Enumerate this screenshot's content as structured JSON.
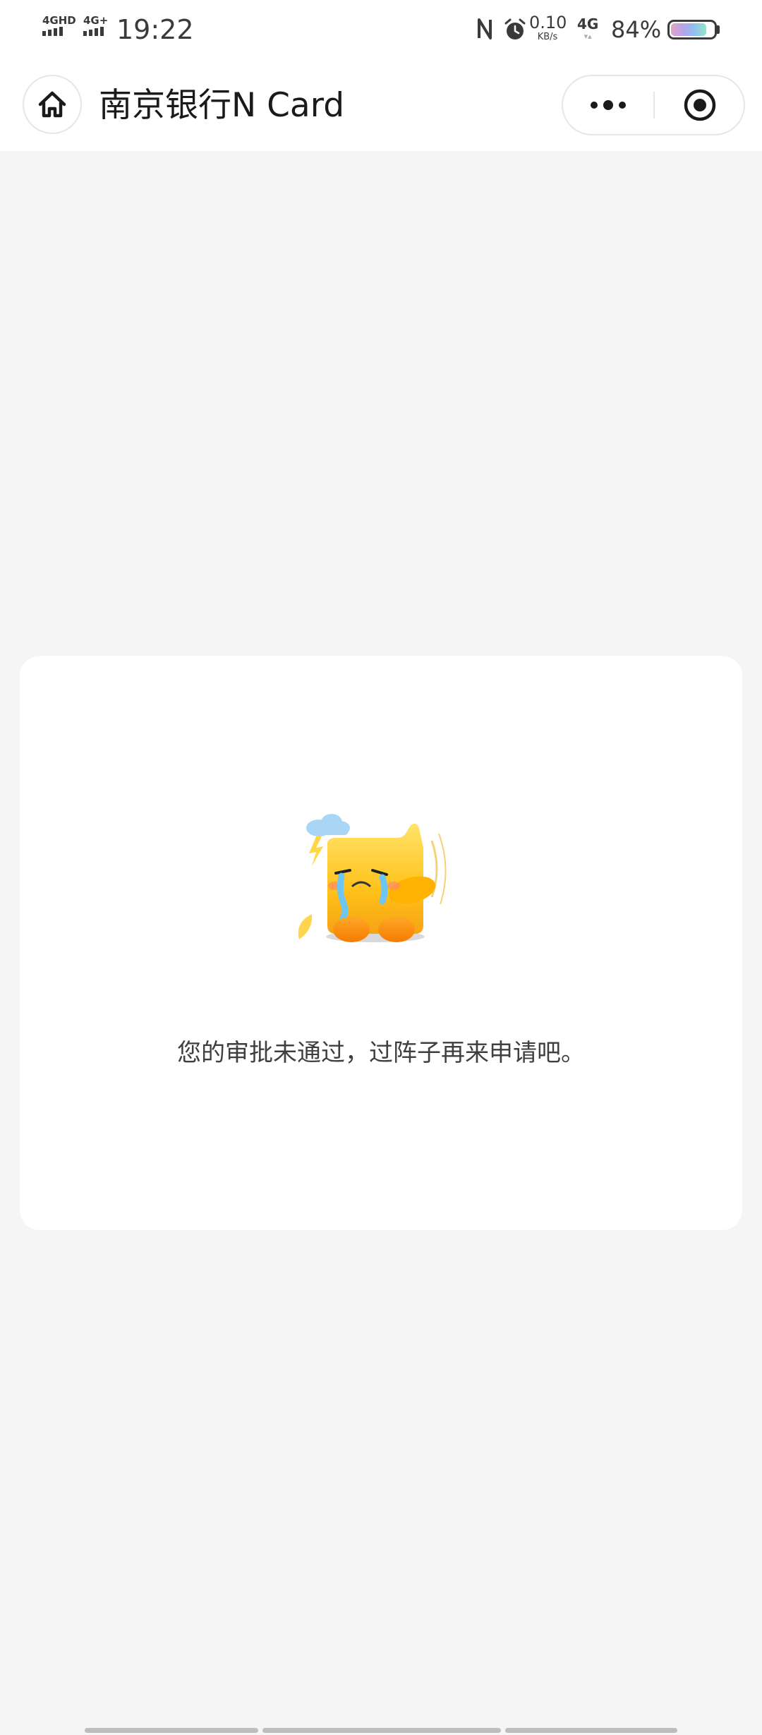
{
  "status_bar": {
    "network_left_1": "4GHD",
    "network_left_2": "4G+",
    "time": "19:22",
    "nfc_icon": "nfc-icon",
    "alarm_icon": "alarm-icon",
    "speed_value": "0.10",
    "speed_unit": "KB/s",
    "network_right": "4G",
    "battery_percent": "84%",
    "battery_level": 0.84
  },
  "nav_bar": {
    "home_icon": "home-icon",
    "title": "南京银行N Card",
    "more_icon": "more-dots-icon",
    "close_icon": "miniprogram-close-icon"
  },
  "result_card": {
    "illustration": "crying-mascot-illustration",
    "message": "您的审批未通过，过阵子再来申请吧。"
  },
  "colors": {
    "page_background": "#f5f5f5",
    "card_background": "#ffffff",
    "mascot_yellow": "#ffc107",
    "mascot_orange": "#f5a623",
    "tear_blue": "#6ec6f0"
  }
}
